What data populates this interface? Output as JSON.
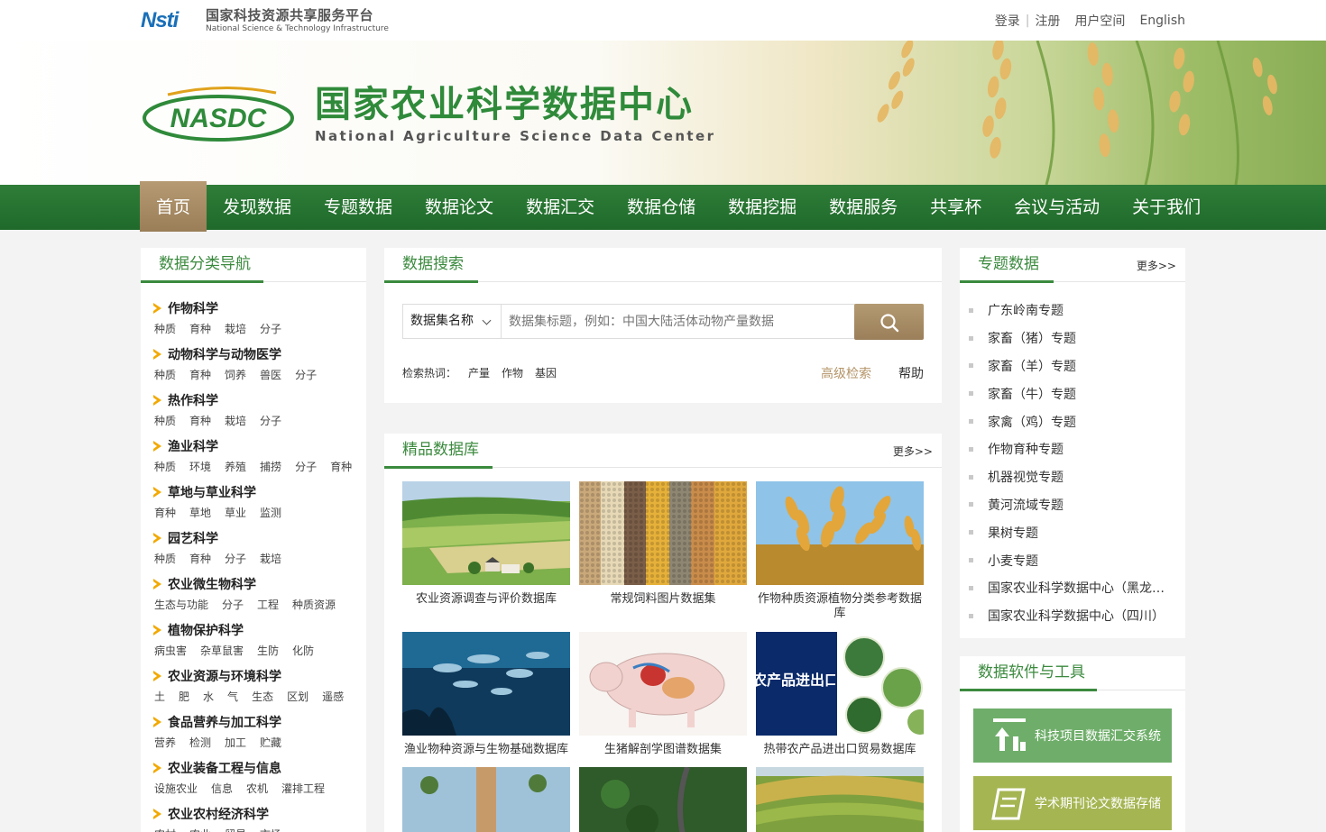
{
  "topbar": {
    "platform_cn": "国家科技资源共享服务平台",
    "platform_en": "National Science & Technology Infrastructure",
    "logo_text": "Nsti",
    "links": {
      "login": "登录",
      "register": "注册",
      "user_space": "用户空间",
      "english": "English"
    }
  },
  "banner": {
    "logo_text": "NASDC",
    "title_cn": "国家农业科学数据中心",
    "title_en": "National Agriculture Science Data Center"
  },
  "nav": [
    "首页",
    "发现数据",
    "专题数据",
    "数据论文",
    "数据汇交",
    "数据仓储",
    "数据挖掘",
    "数据服务",
    "共享杯",
    "会议与活动",
    "关于我们"
  ],
  "left_nav": {
    "title": "数据分类导航",
    "categories": [
      {
        "name": "作物科学",
        "subs": [
          "种质",
          "育种",
          "栽培",
          "分子"
        ]
      },
      {
        "name": "动物科学与动物医学",
        "subs": [
          "种质",
          "育种",
          "饲养",
          "兽医",
          "分子"
        ]
      },
      {
        "name": "热作科学",
        "subs": [
          "种质",
          "育种",
          "栽培",
          "分子"
        ]
      },
      {
        "name": "渔业科学",
        "subs": [
          "种质",
          "环境",
          "养殖",
          "捕捞",
          "分子",
          "育种"
        ]
      },
      {
        "name": "草地与草业科学",
        "subs": [
          "育种",
          "草地",
          "草业",
          "监测"
        ]
      },
      {
        "name": "园艺科学",
        "subs": [
          "种质",
          "育种",
          "分子",
          "栽培"
        ]
      },
      {
        "name": "农业微生物科学",
        "subs": [
          "生态与功能",
          "分子",
          "工程",
          "种质资源"
        ]
      },
      {
        "name": "植物保护科学",
        "subs": [
          "病虫害",
          "杂草鼠害",
          "生防",
          "化防"
        ]
      },
      {
        "name": "农业资源与环境科学",
        "subs": [
          "土",
          "肥",
          "水",
          "气",
          "生态",
          "区划",
          "遥感"
        ]
      },
      {
        "name": "食品营养与加工科学",
        "subs": [
          "营养",
          "检测",
          "加工",
          "贮藏"
        ]
      },
      {
        "name": "农业装备工程与信息",
        "subs": [
          "设施农业",
          "信息",
          "农机",
          "灌排工程"
        ]
      },
      {
        "name": "农业农村经济科学",
        "subs": [
          "农村",
          "农业",
          "贸易",
          "市场"
        ]
      }
    ]
  },
  "search": {
    "title": "数据搜索",
    "select_value": "数据集名称",
    "placeholder": "数据集标题，例如：中国大陆活体动物产量数据",
    "hot_label": "检索热词：",
    "hot_words": [
      "产量",
      "作物",
      "基因"
    ],
    "advanced": "高级检索",
    "help": "帮助"
  },
  "featured": {
    "title": "精品数据库",
    "more": "更多>>",
    "tiles": [
      {
        "caption": "农业资源调查与评价数据库"
      },
      {
        "caption": "常规饲料图片数据集"
      },
      {
        "caption": "作物种质资源植物分类参考数据库"
      },
      {
        "caption": "渔业物种资源与生物基础数据库"
      },
      {
        "caption": "生猪解剖学图谱数据集"
      },
      {
        "caption": "热带农产品进出口贸易数据库",
        "overlay": "农产品进出口"
      }
    ]
  },
  "topics": {
    "title": "专题数据",
    "more": "更多>>",
    "items": [
      "广东岭南专题",
      "家畜（猪）专题",
      "家畜（羊）专题",
      "家畜（牛）专题",
      "家禽（鸡）专题",
      "作物育种专题",
      "机器视觉专题",
      "黄河流域专题",
      "果树专题",
      "小麦专题",
      "国家农业科学数据中心（黑龙…",
      "国家农业科学数据中心（四川）"
    ]
  },
  "tools": {
    "title": "数据软件与工具",
    "buttons": [
      "科技项目数据汇交系统",
      "学术期刊论文数据存储"
    ],
    "colors": [
      "#6fae6a",
      "#a5b552"
    ]
  },
  "colors": {
    "brand_green": "#3b8a3e",
    "nav_green": "#2f7d38",
    "accent_brown": "#b49a72",
    "arrow_yellow": "#f2a900"
  }
}
